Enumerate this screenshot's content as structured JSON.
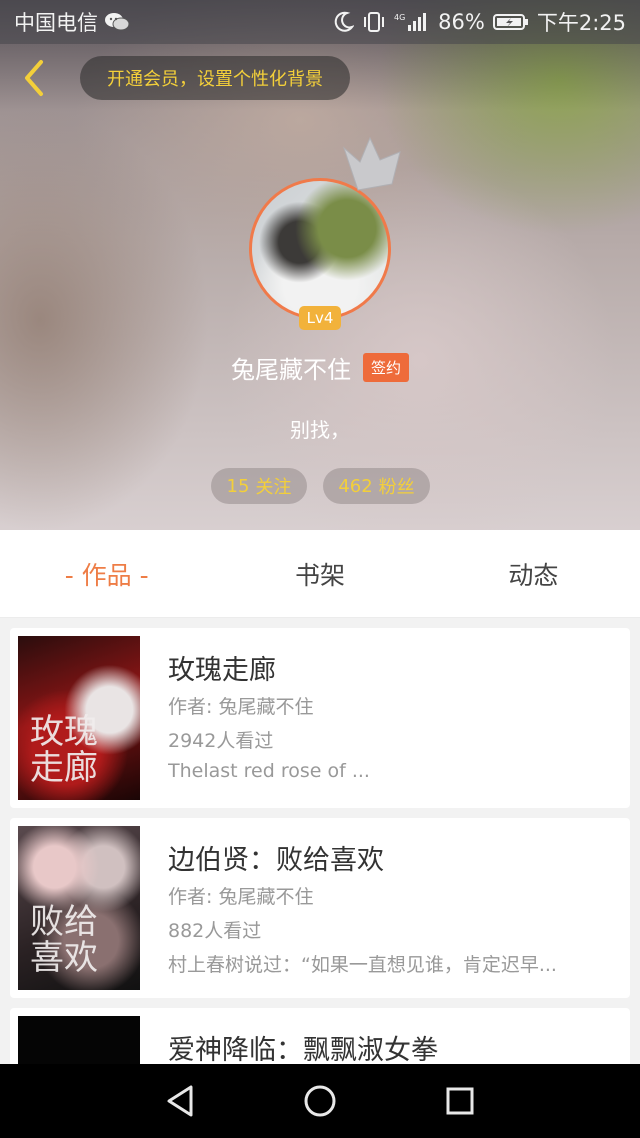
{
  "status_bar": {
    "carrier": "中国电信",
    "signal_label": "4G",
    "battery": "86%",
    "time": "下午2:25",
    "icons": [
      "wechat-icon",
      "moon-icon",
      "vibrate-icon",
      "signal-icon",
      "battery-icon"
    ]
  },
  "header": {
    "vip_banner": "开通会员，设置个性化背景",
    "level": "Lv4",
    "username": "兔尾藏不住",
    "signed_badge": "签约",
    "bio": "别找，",
    "following": {
      "count": "15",
      "label": "关注"
    },
    "followers": {
      "count": "462",
      "label": "粉丝"
    },
    "colors": {
      "accent": "#f3cf3a",
      "avatar_ring": "#f07a4a",
      "badge": "#ee6b3a"
    }
  },
  "tabs": [
    {
      "label": "- 作品 -",
      "active": true
    },
    {
      "label": "书架",
      "active": false
    },
    {
      "label": "动态",
      "active": false
    }
  ],
  "books": [
    {
      "title": "玫瑰走廊",
      "author": "作者: 兔尾藏不住",
      "views": "2942人看过",
      "desc": "Thelast red rose of ...",
      "cover_text": "玫瑰\n走廊"
    },
    {
      "title": "边伯贤：败给喜欢",
      "author": "作者: 兔尾藏不住",
      "views": "882人看过",
      "desc": "村上春树说过：“如果一直想见谁，肯定迟早...",
      "cover_text": "败给\n喜欢"
    },
    {
      "title": "爱神降临：飘飘淑女拳",
      "author": "",
      "views": "",
      "desc": "",
      "cover_text": ""
    }
  ],
  "nav": [
    "back-nav-icon",
    "home-nav-icon",
    "recents-nav-icon"
  ]
}
